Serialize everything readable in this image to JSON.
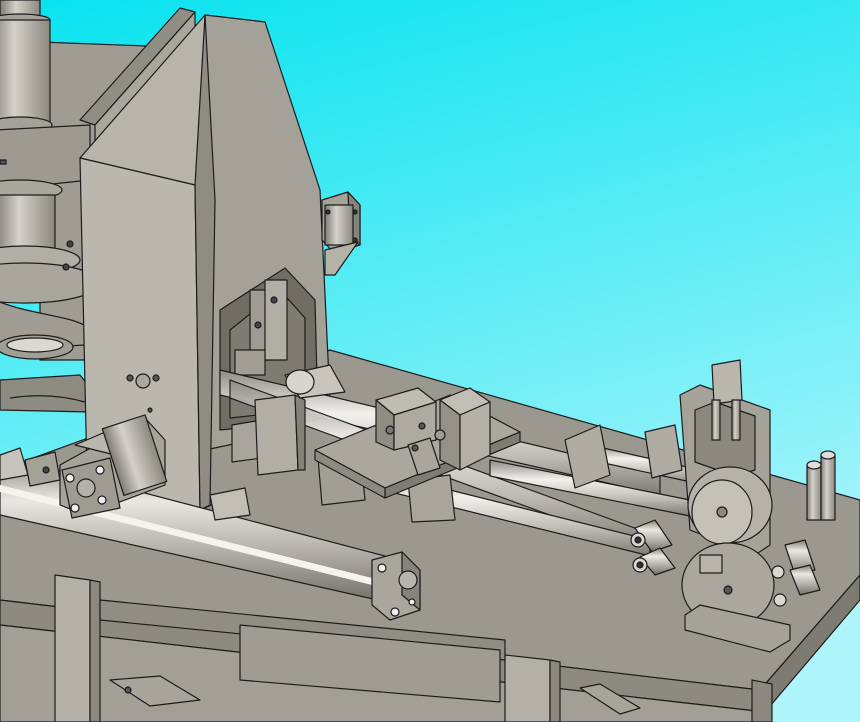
{
  "scene": {
    "background_top": "#0ce6f2",
    "background_bottom": "#a9f4fb",
    "metal_light": "#b3b1a7",
    "metal_mid": "#98968c",
    "metal_dark": "#7a786f",
    "edge": "#1a1a1a"
  },
  "parts": [
    "machine-table",
    "press-frame",
    "main-spindle",
    "front-pneumatic-cylinder",
    "linear-guide-rails",
    "sliding-carriage",
    "roller-feeder",
    "rear-cylinder"
  ]
}
